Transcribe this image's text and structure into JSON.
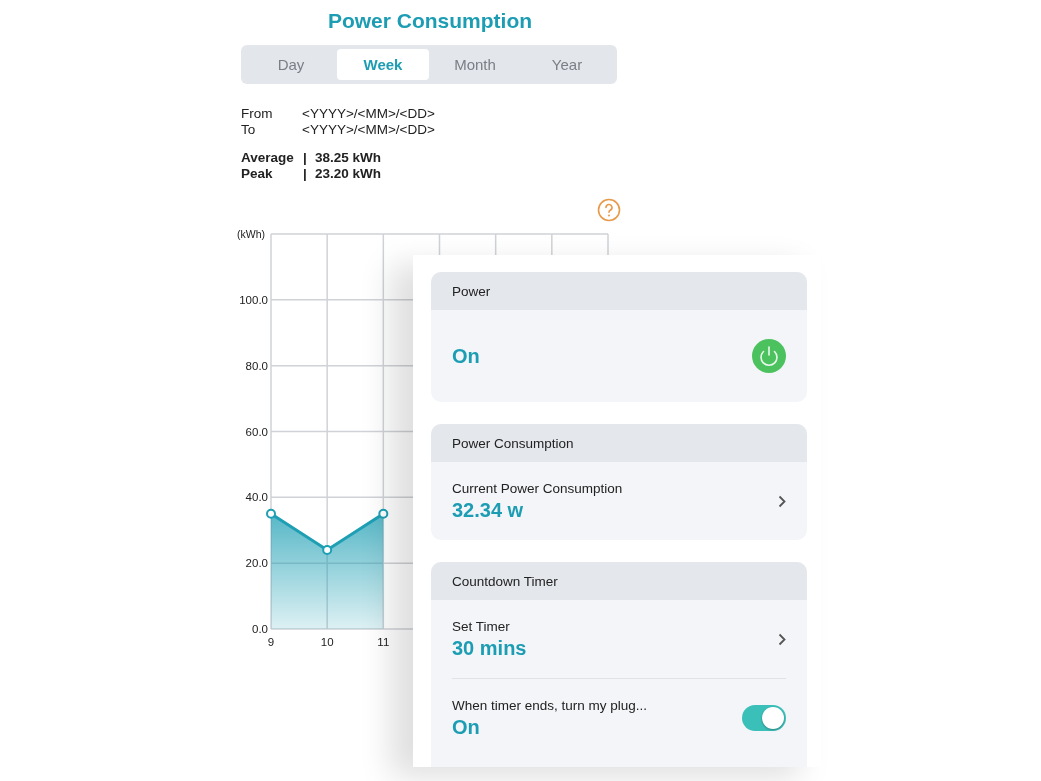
{
  "title": "Power Consumption",
  "tabs": [
    {
      "label": "Day",
      "selected": false
    },
    {
      "label": "Week",
      "selected": true
    },
    {
      "label": "Month",
      "selected": false
    },
    {
      "label": "Year",
      "selected": false
    }
  ],
  "date_range": [
    {
      "label": "From",
      "value": "<YYYY>/<MM>/<DD>"
    },
    {
      "label": "To",
      "value": "<YYYY>/<MM>/<DD>"
    }
  ],
  "stats": [
    {
      "label": "Average",
      "separator": "|",
      "value": "38.25 kWh"
    },
    {
      "label": "Peak",
      "separator": "|",
      "value": "23.20 kWh"
    }
  ],
  "chart": {
    "chart_data": {
      "type": "area",
      "grid": true,
      "ylabel": "(kWh)",
      "x": [
        9,
        10,
        11
      ],
      "xlim": [
        9,
        15
      ],
      "ylim": [
        0,
        120
      ],
      "xticks": [
        9,
        10,
        11
      ],
      "yticks": [
        {
          "value": 0,
          "label": "0.0"
        },
        {
          "value": 20,
          "label": "20.0"
        },
        {
          "value": 40,
          "label": "40.0"
        },
        {
          "value": 60,
          "label": "60.0"
        },
        {
          "value": 80,
          "label": "80.0"
        },
        {
          "value": 100,
          "label": "100.0"
        }
      ],
      "series": [
        {
          "color": "#1e9fb4",
          "values": [
            35,
            24,
            35
          ]
        }
      ]
    }
  },
  "cards": [
    {
      "title": "Power",
      "rows": [
        {
          "kind": "power",
          "value": "On",
          "on": true
        }
      ]
    },
    {
      "title": "Power Consumption",
      "rows": [
        {
          "kind": "link",
          "label": "Current Power Consumption",
          "value": "32.34 w"
        }
      ]
    },
    {
      "title": "Countdown Timer",
      "rows": [
        {
          "kind": "link",
          "label": "Set Timer",
          "value": "30 mins"
        },
        {
          "kind": "toggle",
          "label": "When timer ends, turn my plug...",
          "value": "On",
          "on": true
        }
      ]
    }
  ]
}
